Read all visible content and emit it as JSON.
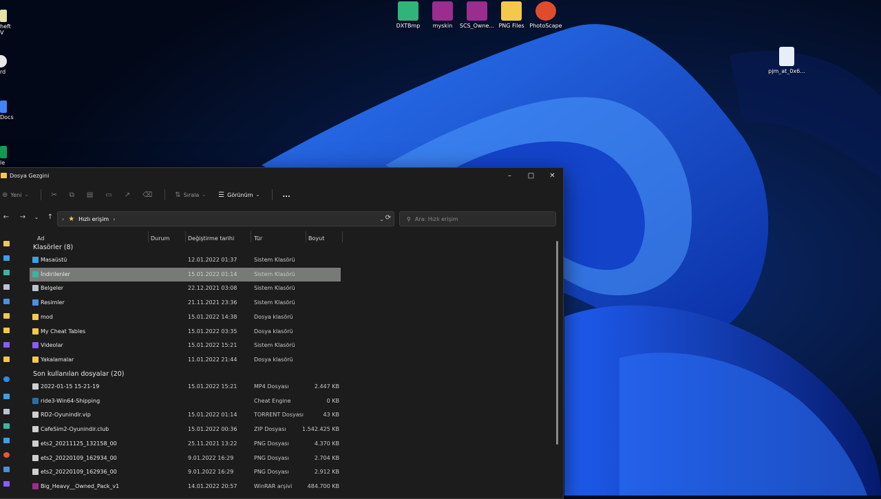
{
  "desktop": {
    "icons": [
      {
        "label": "DXTBmp",
        "icon": "app-icon",
        "color": "#2fb57a"
      },
      {
        "label": "myskin",
        "icon": "winrar-icon",
        "color": "#9b2d8e"
      },
      {
        "label": "SCS_Owne...",
        "icon": "winrar-icon",
        "color": "#9b2d8e"
      },
      {
        "label": "PNG Files",
        "icon": "folder-icon",
        "color": "#f3c94a"
      },
      {
        "label": "PhotoScape",
        "icon": "photoscape-icon",
        "color": "#e04b2e"
      },
      {
        "label": "pjm_at_0x6...",
        "icon": "image-file-icon",
        "color": "#2c6fd1"
      }
    ],
    "left_cut": [
      {
        "label": "heft\nV"
      },
      {
        "label": "rd"
      },
      {
        "label": "Docs"
      },
      {
        "label": "le"
      }
    ]
  },
  "window": {
    "title": "Dosya Gezgini",
    "toolbar": {
      "new": "Yeni",
      "sort": "Sırala",
      "view": "Görünüm",
      "more": "..."
    },
    "address": {
      "path": "Hızlı erişim",
      "search_placeholder": "Ara: Hızlı erişim"
    },
    "columns": [
      "Ad",
      "Durum",
      "Değiştirme tarihi",
      "Tür",
      "Boyut"
    ],
    "groups": [
      {
        "title": "Klasörler (8)",
        "rows": [
          {
            "name": "Masaüstü",
            "date": "12.01.2022 01:37",
            "type": "Sistem Klasörü",
            "size": "",
            "color": "#3aa0e8"
          },
          {
            "name": "İndirilenler",
            "date": "15.01.2022 01:14",
            "type": "Sistem Klasörü",
            "size": "",
            "color": "#3bb5a0",
            "selected": true
          },
          {
            "name": "Belgeler",
            "date": "22.12.2021 03:08",
            "type": "Sistem Klasörü",
            "size": "",
            "color": "#b8c4d4"
          },
          {
            "name": "Resimler",
            "date": "21.11.2021 23:36",
            "type": "Sistem Klasörü",
            "size": "",
            "color": "#4a90e2"
          },
          {
            "name": "mod",
            "date": "15.01.2022 14:38",
            "type": "Dosya klasörü",
            "size": "",
            "color": "#f3c94a"
          },
          {
            "name": "My Cheat Tables",
            "date": "15.01.2022 03:35",
            "type": "Dosya klasörü",
            "size": "",
            "color": "#f3c94a"
          },
          {
            "name": "Videolar",
            "date": "15.01.2022 15:21",
            "type": "Sistem Klasörü",
            "size": "",
            "color": "#8a5cf5"
          },
          {
            "name": "Yakalamalar",
            "date": "11.01.2022 21:44",
            "type": "Dosya klasörü",
            "size": "",
            "color": "#f3c94a"
          }
        ]
      },
      {
        "title": "Son kullanılan dosyalar (20)",
        "rows": [
          {
            "name": "2022-01-15 15-21-19",
            "date": "15.01.2022 15:21",
            "type": "MP4 Dosyası",
            "size": "2.447 KB",
            "color": "#cfcfcf"
          },
          {
            "name": "ride3-Win64-Shipping",
            "date": "",
            "type": "Cheat Engine",
            "size": "0 KB",
            "color": "#2a6fa8"
          },
          {
            "name": "RD2-Oyunindir.vip",
            "date": "15.01.2022 01:14",
            "type": "TORRENT Dosyası",
            "size": "43 KB",
            "color": "#cfcfcf"
          },
          {
            "name": "CafeSim2-Oyunindir.club",
            "date": "15.01.2022 00:36",
            "type": "ZIP Dosyası",
            "size": "1.542.425 KB",
            "color": "#cfcfcf"
          },
          {
            "name": "ets2_20211125_132158_00",
            "date": "25.11.2021 13:22",
            "type": "PNG Dosyası",
            "size": "4.370 KB",
            "color": "#cfcfcf"
          },
          {
            "name": "ets2_20220109_162934_00",
            "date": "9.01.2022 16:29",
            "type": "PNG Dosyası",
            "size": "2.704 KB",
            "color": "#cfcfcf"
          },
          {
            "name": "ets2_20220109_162936_00",
            "date": "9.01.2022 16:29",
            "type": "PNG Dosyası",
            "size": "2.912 KB",
            "color": "#cfcfcf"
          },
          {
            "name": "Big_Heavy__Owned_Pack_v1",
            "date": "14.01.2022 20:57",
            "type": "WinRAR arşivi",
            "size": "484.700 KB",
            "color": "#9b2d8e"
          }
        ]
      }
    ]
  }
}
